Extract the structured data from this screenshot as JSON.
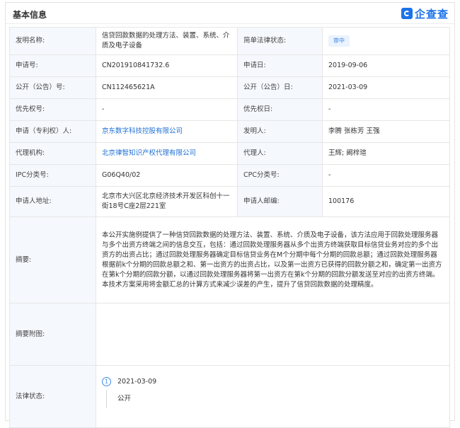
{
  "header": {
    "section_title": "基本信息",
    "logo_text": "企查查",
    "logo_icon": "qichacha-logo-icon",
    "brand_color": "#1c73e8"
  },
  "fields": {
    "invention_name_label": "发明名称:",
    "invention_name": "信贷回款数据的处理方法、装置、系统、介质及电子设备",
    "legal_status_simple_label": "简单法律状态:",
    "legal_status_simple": "审中",
    "app_no_label": "申请号:",
    "app_no": "CN201910841732.6",
    "app_date_label": "申请日:",
    "app_date": "2019-09-06",
    "pub_no_label": "公开（公告）号:",
    "pub_no": "CN112465621A",
    "pub_date_label": "公开（公告）日:",
    "pub_date": "2021-03-09",
    "priority_no_label": "优先权号:",
    "priority_no": "-",
    "priority_date_label": "优先权日:",
    "priority_date": "-",
    "applicant_label": "申请（专利权）人:",
    "applicant": "京东数字科技控股有限公司",
    "inventor_label": "发明人:",
    "inventor": "李腾 张栋芳 王强",
    "agency_label": "代理机构:",
    "agency": "北京律智知识产权代理有限公司",
    "agent_label": "代理人:",
    "agent": "王辉; 阚梓瑄",
    "ipc_label": "IPC分类号:",
    "ipc": "G06Q40/02",
    "cpc_label": "CPC分类号:",
    "cpc": "-",
    "address_label": "申请人地址:",
    "address": "北京市大兴区北京经济技术开发区科创十一街18号C座2层221室",
    "postcode_label": "申请人邮编:",
    "postcode": "100176",
    "abstract_label": "摘要:",
    "abstract": "本公开实施例提供了一种信贷回款数据的处理方法、装置、系统、介质及电子设备，该方法应用于回款处理服务器与多个出资方终端之间的信息交互，包括：通过回款处理服务器从多个出资方终端获取目标信贷业务对应的多个出资方的出资占比；通过回款处理服务器确定目标信贷业务在M个分期中每个分期的回款总额；通过回款处理服务器根据前k个分期的回款总额之和、第一出资方的出资占比，以及第一出资方已获得的回款分额之和，确定第一出资方在第k个分期的回款分额，以通过回款处理服务器将第一出资方在第k个分期的回款分额发送至对应的出资方终端。本技术方案采用将金额汇总的计算方式来减少误差的产生，提升了信贷回款数据的处理精度。",
    "abstract_figure_label": "摘要附图:",
    "abstract_figure": "",
    "legal_status_label": "法律状态:",
    "legal_step_number": "1",
    "legal_step_date": "2021-03-09",
    "legal_step_status": "公开"
  }
}
